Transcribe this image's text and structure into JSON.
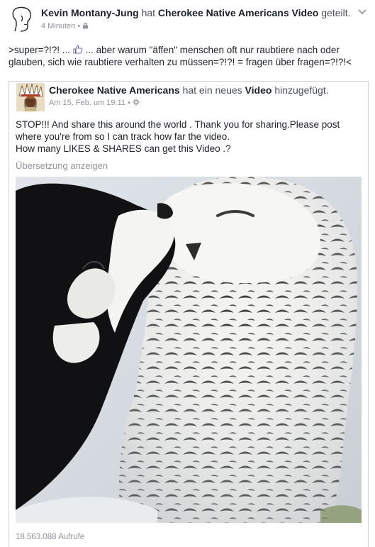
{
  "post": {
    "author": "Kevin Montany-Jung",
    "verb_has": "hat",
    "shared_page": "Cherokee Native Americans Video",
    "verb_shared": "geteilt.",
    "time": "4 Minuten",
    "meta_dot": "•",
    "text_before_emoji": ">super=?!?! ...",
    "text_after_emoji": "... aber warum \"äffen\" menschen oft nur raubtiere nach oder glauben, sich wie raubtiere verhalten zu müssen=?!?! = fragen über fragen=?!?!<",
    "emoji": "thumbs-up"
  },
  "shared": {
    "page_name": "Cherokee Native Americans",
    "action_prefix": "hat ein neues",
    "action_object": "Video",
    "action_suffix": "hinzugefügt.",
    "date": "Am 15. Feb. um 19:11",
    "meta_dot": "•",
    "text_line1": "STOP!!! And share this around the world . Thank you for sharing.Please post where you're from so I can track how far the video.",
    "text_line2": "How many LIKES & SHARES can get this Video .?",
    "translate_link": "Übersetzung anzeigen",
    "views": "18.563.088 Aufrufe"
  },
  "icons": {
    "privacy": "lock-icon",
    "audience": "gear-icon",
    "menu": "chevron-down-icon"
  }
}
